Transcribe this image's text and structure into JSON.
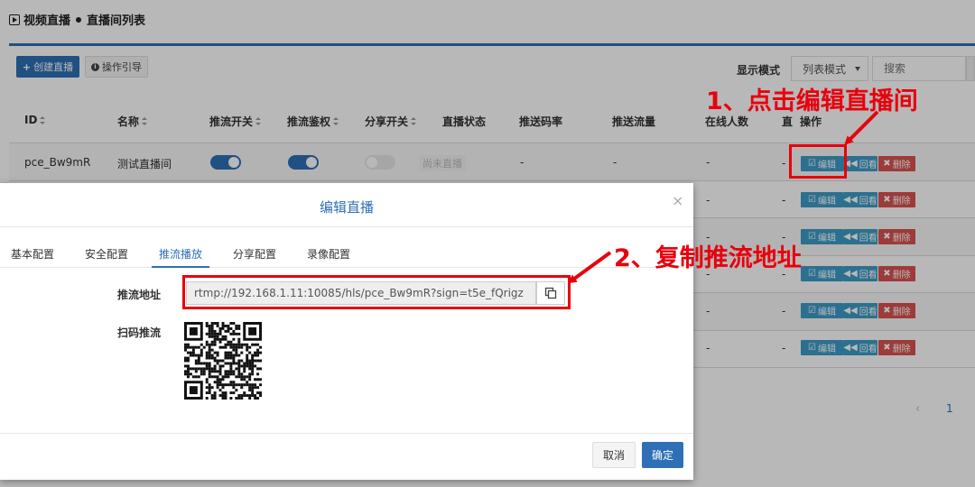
{
  "breadcrumb": {
    "section": "视频直播",
    "page": "直播间列表"
  },
  "toolbar": {
    "create_label": "创建直播",
    "guide_label": "操作引导",
    "mode_label": "显示模式",
    "mode_value": "列表模式",
    "search_placeholder": "搜索"
  },
  "table": {
    "headers": [
      "ID",
      "名称",
      "推流开关",
      "推流鉴权",
      "分享开关",
      "直播状态",
      "推送码率",
      "推送流量",
      "在线人数",
      "直",
      "操作"
    ],
    "row1": {
      "id": "pce_Bw9mR",
      "name": "测试直播间",
      "push_switch": true,
      "push_auth": true,
      "share_switch": false,
      "status": "尚未直播",
      "bitrate": "-",
      "traffic": "-",
      "online": "-"
    },
    "dash": "-",
    "actions": {
      "edit": "编辑",
      "playback": "回看",
      "delete": "删除"
    }
  },
  "pagination": {
    "prev": "‹",
    "current": "1"
  },
  "modal": {
    "title": "编辑直播",
    "close": "×",
    "tabs": [
      "基本配置",
      "安全配置",
      "推流播放",
      "分享配置",
      "录像配置"
    ],
    "active_tab": "推流播放",
    "push_url_label": "推流地址",
    "push_url": "rtmp://192.168.1.11:10085/hls/pce_Bw9mR?sign=t5e_fQrigz",
    "qr_label": "扫码推流",
    "cancel_label": "取消",
    "ok_label": "确定"
  },
  "annotations": {
    "step1": "1、点击编辑直播间",
    "step2": "2、复制推流地址",
    "color": "#e8000d"
  },
  "colors": {
    "primary": "#2f6fb6",
    "info": "#3d9cc6",
    "danger": "#d9534f"
  }
}
